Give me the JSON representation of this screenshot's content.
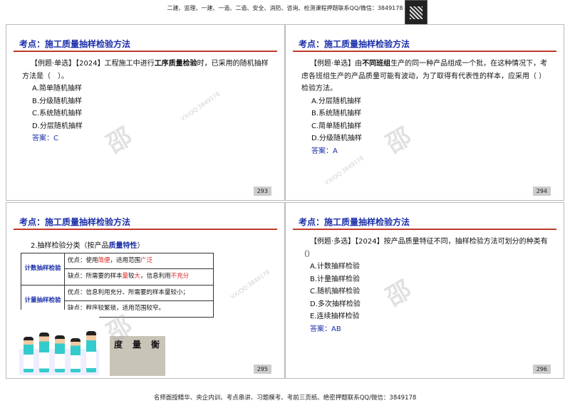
{
  "header": "二建、监理、一建、一造、二造、安全、消防、咨询、检测课程押题联系QQ/微信：3849178",
  "footer": "名师面授精华、央企内训、考点串讲、习题模考、考前三页纸、绝密押题联系QQ/微信：3849178",
  "watermark": "VX/QQ:3849178",
  "watermark_char": "邵",
  "slides": [
    {
      "title": "考点：施工质量抽样检验方法",
      "q1": "【例题·单选】【2024】工程施工中进行",
      "q_bold": "工序质量检验",
      "q2": "时，已采用的随机抽样方法是（　）。",
      "options": [
        "A.简单随机抽样",
        "B.分级随机抽样",
        "C.系统随机抽样",
        "D.分层随机抽样"
      ],
      "answer": "答案：C",
      "page": "293"
    },
    {
      "title": "考点：施工质量抽样检验方法",
      "q1": "【例题·单选】由",
      "q_bold": "不同班组",
      "q2": "生产的同一种产品组成一个批，在这种情况下，考虑各班组生产的产品质量可能有波动，为了取得有代表性的样本，应采用（ ）检验方法。",
      "options": [
        "A.分层随机抽样",
        "B.系统随机抽样",
        "C.简单随机抽样",
        "D.分级随机抽样"
      ],
      "answer": "答案：A",
      "page": "294"
    },
    {
      "title": "考点：施工质量抽样检验方法",
      "heading1": "2.抽样检验分类（按产品",
      "heading_bold": "质量特性",
      "heading2": "）",
      "table": [
        {
          "type": "计数抽样检验",
          "pro": [
            "优点：使用",
            "简便",
            "，适用范围",
            "广泛"
          ],
          "con": [
            "缺点：所需要的样本",
            "量",
            "较",
            "大",
            "，信息利用",
            "不充分"
          ]
        },
        {
          "type": "计量抽样检验",
          "pro": "优点：信息利用充分、所需要的样本量较小；",
          "con": "缺点：程序较繁琐，适用范围较窄。"
        }
      ],
      "image_title": [
        "度",
        "量",
        "衡"
      ],
      "page": "295"
    },
    {
      "title": "考点：施工质量抽样检验方法",
      "q": "【例题·多选】【2024】按产品质量特征不同，抽样检验方法可划分的种类有（）",
      "options": [
        "A.计数抽样检验",
        "B.计量抽样检验",
        "C.随机抽样检验",
        "D.多次抽样检验",
        "E.连续抽样检验"
      ],
      "answer": "答案：AB",
      "page": "296"
    }
  ]
}
